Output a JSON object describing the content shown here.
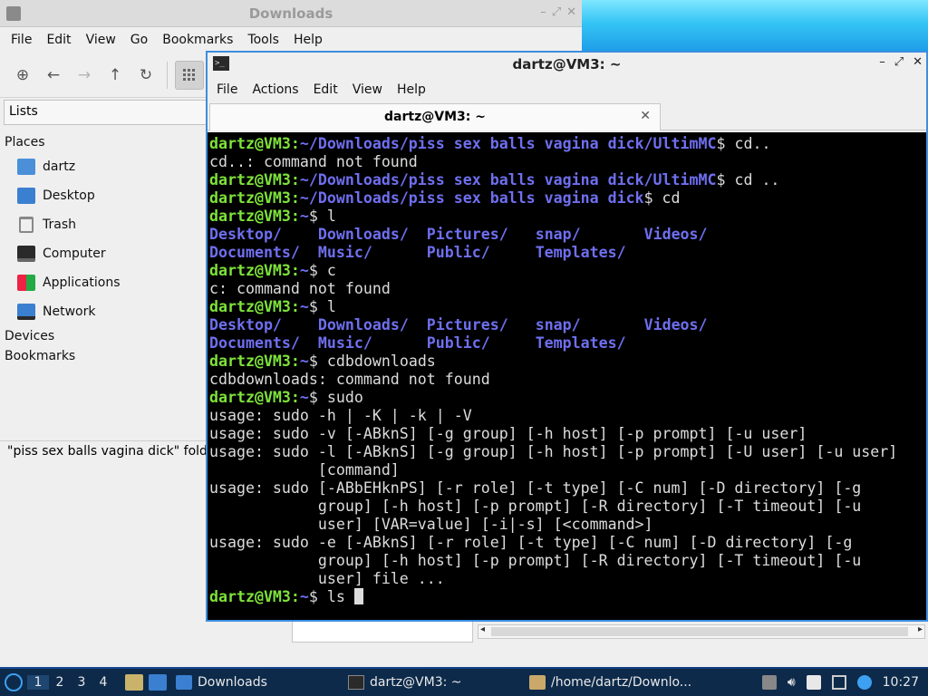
{
  "file_manager": {
    "title": "Downloads",
    "menu": [
      "File",
      "Edit",
      "View",
      "Go",
      "Bookmarks",
      "Tools",
      "Help"
    ],
    "sidebar_header": "Lists",
    "sections": {
      "places": "Places",
      "devices": "Devices",
      "bookmarks": "Bookmarks"
    },
    "places": [
      {
        "label": "dartz",
        "icon": "home-folder-icon"
      },
      {
        "label": "Desktop",
        "icon": "desktop-folder-icon"
      },
      {
        "label": "Trash",
        "icon": "trash-icon"
      },
      {
        "label": "Computer",
        "icon": "computer-icon"
      },
      {
        "label": "Applications",
        "icon": "applications-icon"
      },
      {
        "label": "Network",
        "icon": "network-icon"
      }
    ],
    "status": "\"piss sex balls vagina dick\" folde"
  },
  "terminal": {
    "title": "dartz@VM3: ~",
    "menu": [
      "File",
      "Actions",
      "Edit",
      "View",
      "Help"
    ],
    "tab_label": "dartz@VM3: ~",
    "lines": [
      {
        "type": "prompt",
        "user": "dartz@VM3",
        "path": "~/Downloads/piss sex balls vagina dick/UltimMC",
        "cmd": " cd.."
      },
      {
        "type": "out",
        "text": "cd..: command not found"
      },
      {
        "type": "prompt",
        "user": "dartz@VM3",
        "path": "~/Downloads/piss sex balls vagina dick/UltimMC",
        "cmd": " cd .."
      },
      {
        "type": "prompt",
        "user": "dartz@VM3",
        "path": "~/Downloads/piss sex balls vagina dick",
        "cmd": " cd"
      },
      {
        "type": "prompt",
        "user": "dartz@VM3",
        "path": "~",
        "cmd": " l"
      },
      {
        "type": "dirs",
        "items": [
          "Desktop/",
          "Downloads/",
          "Pictures/",
          "snap/",
          "Videos/"
        ]
      },
      {
        "type": "dirs",
        "items": [
          "Documents/",
          "Music/",
          "Public/",
          "Templates/"
        ]
      },
      {
        "type": "prompt",
        "user": "dartz@VM3",
        "path": "~",
        "cmd": " c"
      },
      {
        "type": "out",
        "text": "c: command not found"
      },
      {
        "type": "prompt",
        "user": "dartz@VM3",
        "path": "~",
        "cmd": " l"
      },
      {
        "type": "dirs",
        "items": [
          "Desktop/",
          "Downloads/",
          "Pictures/",
          "snap/",
          "Videos/"
        ]
      },
      {
        "type": "dirs",
        "items": [
          "Documents/",
          "Music/",
          "Public/",
          "Templates/"
        ]
      },
      {
        "type": "prompt",
        "user": "dartz@VM3",
        "path": "~",
        "cmd": " cdbdownloads"
      },
      {
        "type": "out",
        "text": "cdbdownloads: command not found"
      },
      {
        "type": "prompt",
        "user": "dartz@VM3",
        "path": "~",
        "cmd": " sudo"
      },
      {
        "type": "out",
        "text": "usage: sudo -h | -K | -k | -V"
      },
      {
        "type": "out",
        "text": "usage: sudo -v [-ABknS] [-g group] [-h host] [-p prompt] [-u user]"
      },
      {
        "type": "out",
        "text": "usage: sudo -l [-ABknS] [-g group] [-h host] [-p prompt] [-U user] [-u user]"
      },
      {
        "type": "out",
        "text": "            [command]"
      },
      {
        "type": "out",
        "text": "usage: sudo [-ABbEHknPS] [-r role] [-t type] [-C num] [-D directory] [-g"
      },
      {
        "type": "out",
        "text": "            group] [-h host] [-p prompt] [-R directory] [-T timeout] [-u"
      },
      {
        "type": "out",
        "text": "            user] [VAR=value] [-i|-s] [<command>]"
      },
      {
        "type": "out",
        "text": "usage: sudo -e [-ABknS] [-r role] [-t type] [-C num] [-D directory] [-g"
      },
      {
        "type": "out",
        "text": "            group] [-h host] [-p prompt] [-R directory] [-T timeout] [-u"
      },
      {
        "type": "out",
        "text": "            user] file ..."
      },
      {
        "type": "prompt_active",
        "user": "dartz@VM3",
        "path": "~",
        "cmd": " ls "
      }
    ]
  },
  "taskbar": {
    "workspaces": [
      "1",
      "2",
      "3",
      "4"
    ],
    "active_workspace": "1",
    "tasks": [
      {
        "label": "Downloads",
        "icon": "folder-icon"
      },
      {
        "label": "dartz@VM3: ~",
        "icon": "terminal-icon"
      },
      {
        "label": "/home/dartz/Downlo...",
        "icon": "archive-icon"
      }
    ],
    "clock": "10:27"
  },
  "colors": {
    "prompt_user": "#7ee33a",
    "prompt_path": "#6f6ff0",
    "terminal_bg": "#000000",
    "active_border": "#3d8ee0",
    "taskbar_bg": "#0d2a4a"
  }
}
